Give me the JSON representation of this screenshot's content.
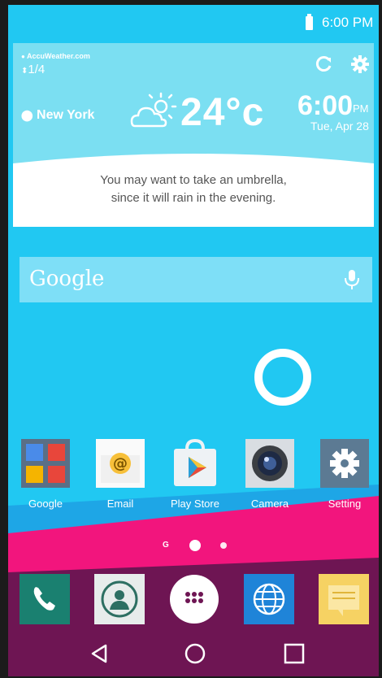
{
  "status_bar": {
    "time": "6:00 PM"
  },
  "weather": {
    "provider": "AccuWeather.com",
    "page_indicator": "1/4",
    "city": "New York",
    "temperature": "24°c",
    "time": "6:00",
    "ampm": "PM",
    "date": "Tue, Apr 28",
    "message_line1": "You may want to take an umbrella,",
    "message_line2": "since it will rain in the evening."
  },
  "search": {
    "logo": "Google"
  },
  "apps": [
    {
      "label": "Google",
      "icon": "google-folder-icon"
    },
    {
      "label": "Email",
      "icon": "email-icon"
    },
    {
      "label": "Play Store",
      "icon": "play-store-icon"
    },
    {
      "label": "Camera",
      "icon": "camera-icon"
    },
    {
      "label": "Setting",
      "icon": "gear-icon"
    }
  ],
  "home_pages": {
    "google_marker": "G",
    "count": 2,
    "current": 1
  },
  "dock": [
    {
      "icon": "phone-icon"
    },
    {
      "icon": "contacts-icon"
    },
    {
      "icon": "apps-drawer-icon"
    },
    {
      "icon": "browser-globe-icon"
    },
    {
      "icon": "notes-icon"
    }
  ],
  "navigation": [
    "back-icon",
    "home-icon",
    "recents-icon"
  ],
  "colors": {
    "sky": "#21c8f2",
    "band_blue": "#1ea6e6",
    "band_pink": "#f2157d",
    "band_purple": "#6e1553",
    "weather_card": "#7bdff2"
  }
}
